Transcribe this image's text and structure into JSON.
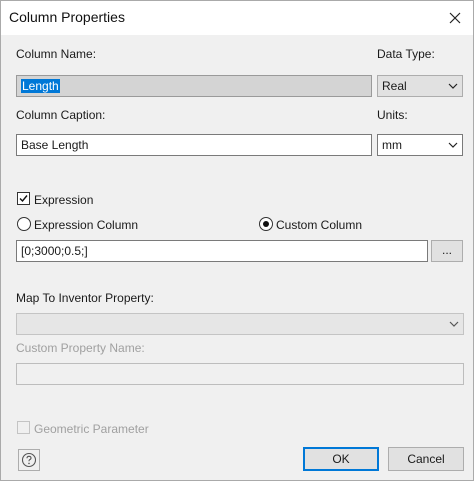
{
  "window": {
    "title": "Column Properties"
  },
  "column_name": {
    "label": "Column Name:",
    "value": "Length"
  },
  "data_type": {
    "label": "Data Type:",
    "value": "Real"
  },
  "column_caption": {
    "label": "Column Caption:",
    "value": "Base Length"
  },
  "units": {
    "label": "Units:",
    "value": "mm"
  },
  "expression": {
    "label": "Expression",
    "checked": true
  },
  "expression_column": {
    "label": "Expression Column",
    "selected": false
  },
  "custom_column": {
    "label": "Custom Column",
    "selected": true
  },
  "expression_field": {
    "value": "[0;3000;0.5;]",
    "browse_label": "..."
  },
  "map_inventor": {
    "label": "Map To Inventor Property:",
    "value": ""
  },
  "custom_property_name": {
    "label": "Custom Property Name:",
    "value": ""
  },
  "geometric_parameter": {
    "label": "Geometric Parameter",
    "checked": false
  },
  "buttons": {
    "ok": "OK",
    "cancel": "Cancel",
    "help_icon": "question-circle-icon"
  },
  "colors": {
    "accent": "#0078d7",
    "background": "#f0f0f0"
  }
}
